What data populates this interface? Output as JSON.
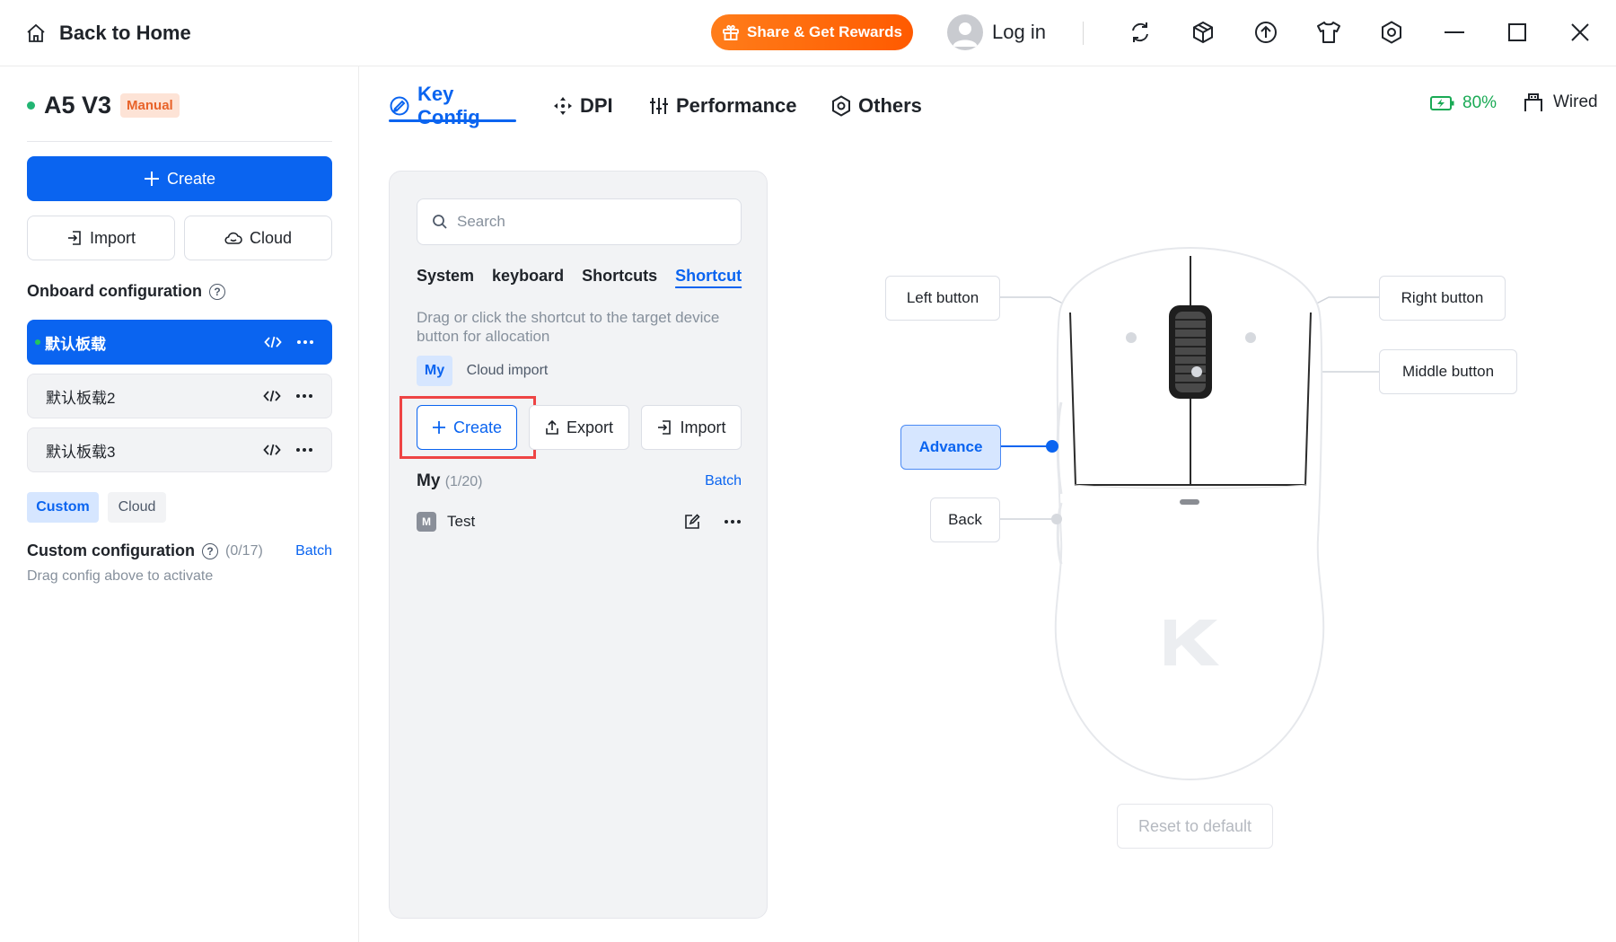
{
  "titlebar": {
    "back_label": "Back to Home",
    "share_label": "Share & Get Rewards",
    "login_label": "Log in",
    "icons": [
      "sync-icon",
      "cube-icon",
      "upload-icon",
      "tshirt-icon",
      "settings-hex-icon",
      "minimize-icon",
      "maximize-icon",
      "close-icon"
    ]
  },
  "device": {
    "name": "A5 V3",
    "mode_badge": "Manual",
    "create_label": "Create",
    "import_label": "Import",
    "cloud_label": "Cloud"
  },
  "onboard": {
    "title": "Onboard configuration",
    "items": [
      {
        "label": "默认板载",
        "active": true
      },
      {
        "label": "默认板载2",
        "active": false
      },
      {
        "label": "默认板载3",
        "active": false
      }
    ]
  },
  "config_tabs": {
    "custom": "Custom",
    "cloud": "Cloud"
  },
  "custom_config": {
    "title": "Custom configuration",
    "count": "(0/17)",
    "batch": "Batch",
    "hint": "Drag config above to activate"
  },
  "main_tabs": [
    {
      "label": "Key Config",
      "icon": "key-config-icon",
      "active": true
    },
    {
      "label": "DPI",
      "icon": "dpi-icon",
      "active": false
    },
    {
      "label": "Performance",
      "icon": "sliders-icon",
      "active": false
    },
    {
      "label": "Others",
      "icon": "hex-icon",
      "active": false
    }
  ],
  "status": {
    "battery": "80%",
    "connection": "Wired",
    "accent": "#0a64f0",
    "battery_color": "#1aaa55"
  },
  "shortcut_panel": {
    "search_placeholder": "Search",
    "categories": [
      "System",
      "keyboard",
      "Shortcuts",
      "Shortcut"
    ],
    "active_category": "Shortcut",
    "hint": "Drag or click the shortcut to the target device button for allocation",
    "sub_tabs": {
      "my": "My",
      "cloud_import": "Cloud import"
    },
    "create_label": "Create",
    "export_label": "Export",
    "import_label": "Import",
    "my_title": "My",
    "my_count": "(1/20)",
    "batch": "Batch",
    "macros": [
      {
        "badge": "M",
        "name": "Test"
      }
    ]
  },
  "mouse": {
    "left_button": "Left button",
    "right_button": "Right button",
    "middle_button": "Middle button",
    "advance": "Advance",
    "back": "Back",
    "reset": "Reset to default"
  }
}
